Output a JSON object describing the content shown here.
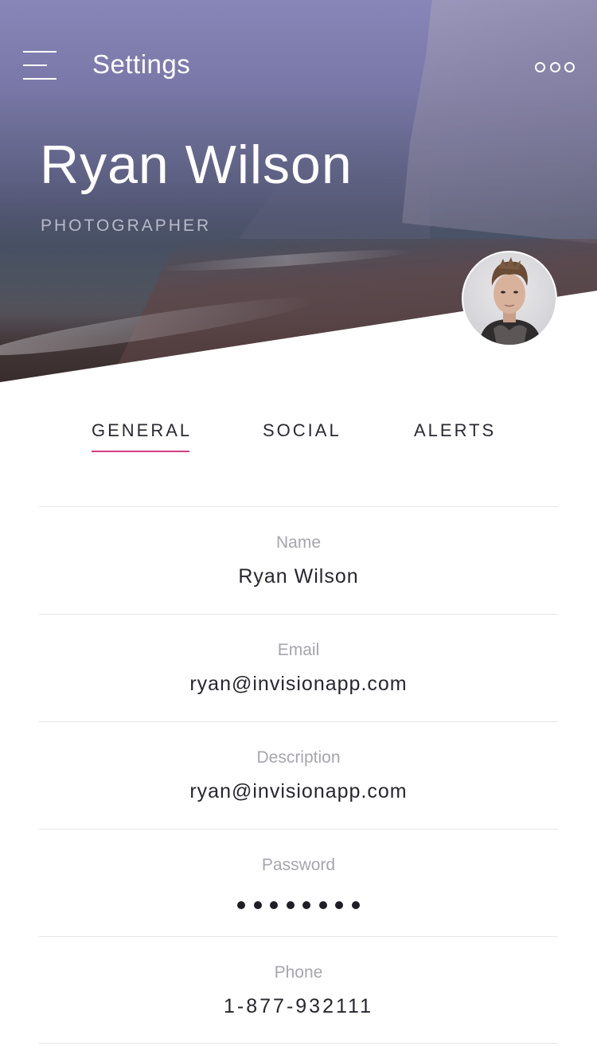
{
  "header": {
    "title": "Settings",
    "menu_icon": "hamburger-menu-icon",
    "more_icon": "more-dots-icon"
  },
  "profile": {
    "name": "Ryan Wilson",
    "role": "PHOTOGRAPHER"
  },
  "tabs": [
    {
      "label": "GENERAL",
      "active": true
    },
    {
      "label": "SOCIAL",
      "active": false
    },
    {
      "label": "ALERTS",
      "active": false
    }
  ],
  "fields": [
    {
      "label": "Name",
      "value": "Ryan Wilson"
    },
    {
      "label": "Email",
      "value": "ryan@invisionapp.com"
    },
    {
      "label": "Description",
      "value": "ryan@invisionapp.com"
    },
    {
      "label": "Password",
      "masked_length": 8
    },
    {
      "label": "Phone",
      "value": "1-877-932111"
    }
  ],
  "colors": {
    "accent": "#d43f7f",
    "text_primary": "#26262e",
    "text_label": "#a5a5ad",
    "divider": "#e6e6ea"
  }
}
